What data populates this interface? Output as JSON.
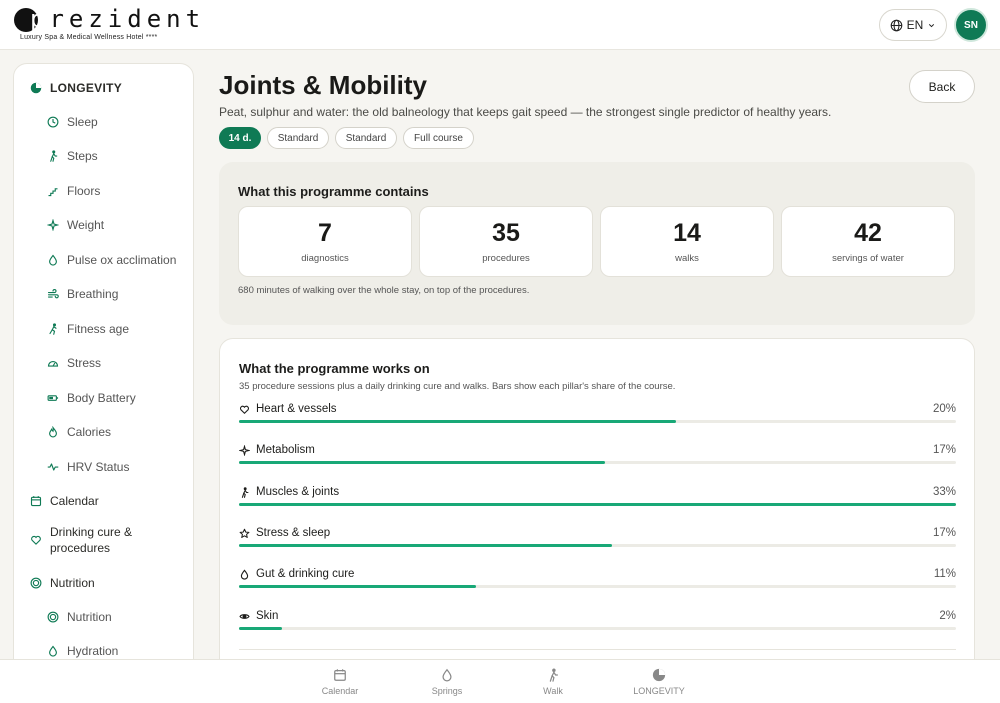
{
  "brand": {
    "logo_first": "p",
    "logo_rest": "rezident",
    "tagline": "Luxury Spa & Medical Wellness Hotel ****"
  },
  "header": {
    "language": "EN",
    "user_initials": "SN"
  },
  "sidebar": {
    "items": [
      {
        "label": "LONGEVITY",
        "icon": "longevity-icon",
        "level": "top"
      },
      {
        "label": "Sleep",
        "icon": "clock-icon",
        "level": "sub"
      },
      {
        "label": "Steps",
        "icon": "walker-icon",
        "level": "sub"
      },
      {
        "label": "Floors",
        "icon": "stairs-icon",
        "level": "sub"
      },
      {
        "label": "Weight",
        "icon": "sparkle-icon",
        "level": "sub"
      },
      {
        "label": "Pulse ox acclimation",
        "icon": "drop-icon",
        "level": "sub"
      },
      {
        "label": "Breathing",
        "icon": "wind-icon",
        "level": "sub"
      },
      {
        "label": "Fitness age",
        "icon": "runner-icon",
        "level": "sub"
      },
      {
        "label": "Stress",
        "icon": "gauge-icon",
        "level": "sub"
      },
      {
        "label": "Body Battery",
        "icon": "battery-icon",
        "level": "sub"
      },
      {
        "label": "Calories",
        "icon": "flame-icon",
        "level": "sub"
      },
      {
        "label": "HRV Status",
        "icon": "pulse-icon",
        "level": "sub"
      },
      {
        "label": "Calendar",
        "icon": "calendar-icon",
        "level": "top"
      },
      {
        "label": "Drinking cure & procedures",
        "icon": "heart-icon",
        "level": "top"
      },
      {
        "label": "Nutrition",
        "icon": "target-icon",
        "level": "top"
      },
      {
        "label": "Nutrition",
        "icon": "target-icon",
        "level": "sub"
      },
      {
        "label": "Hydration",
        "icon": "drop-icon",
        "level": "sub"
      }
    ]
  },
  "page": {
    "title": "Joints & Mobility",
    "subtitle": "Peat, sulphur and water: the old balneology that keeps gait speed — the strongest single predictor of healthy years.",
    "back_label": "Back",
    "chips": [
      "14 d.",
      "Standard",
      "Standard",
      "Full course"
    ]
  },
  "contains": {
    "heading": "What this programme contains",
    "stats": [
      {
        "value": "7",
        "label": "diagnostics"
      },
      {
        "value": "35",
        "label": "procedures"
      },
      {
        "value": "14",
        "label": "walks"
      },
      {
        "value": "42",
        "label": "servings of water"
      }
    ],
    "note": "680 minutes of walking over the whole stay, on top of the procedures."
  },
  "works_on": {
    "heading": "What the programme works on",
    "description": "35 procedure sessions plus a daily drinking cure and walks. Bars show each pillar's share of the course.",
    "pillars": [
      {
        "label": "Heart & vessels",
        "percent_label": "20%",
        "share": 0.61,
        "icon": "heart-icon"
      },
      {
        "label": "Metabolism",
        "percent_label": "17%",
        "share": 0.51,
        "icon": "sparkle-icon"
      },
      {
        "label": "Muscles & joints",
        "percent_label": "33%",
        "share": 1.0,
        "icon": "walker-icon"
      },
      {
        "label": "Stress & sleep",
        "percent_label": "17%",
        "share": 0.52,
        "icon": "star-icon"
      },
      {
        "label": "Gut & drinking cure",
        "percent_label": "11%",
        "share": 0.33,
        "icon": "drop-icon"
      },
      {
        "label": "Skin",
        "percent_label": "2%",
        "share": 0.06,
        "icon": "eye-icon"
      }
    ]
  },
  "bottom_nav": [
    {
      "label": "Calendar",
      "icon": "calendar-icon"
    },
    {
      "label": "Springs",
      "icon": "drop-icon"
    },
    {
      "label": "Walk",
      "icon": "walker-icon"
    },
    {
      "label": "LONGEVITY",
      "icon": "longevity-icon"
    }
  ],
  "colors": {
    "accent": "#0f7a55",
    "bar": "#18a877",
    "panel": "#efeee8"
  }
}
